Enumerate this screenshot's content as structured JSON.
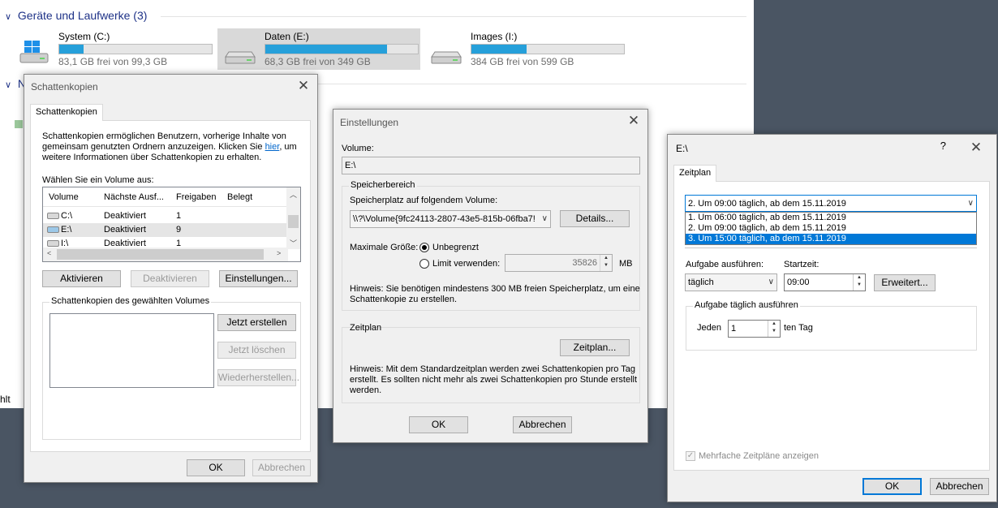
{
  "explorer": {
    "section_title": "Geräte und Laufwerke (3)",
    "section_chevron": "∨",
    "network_chevron": "∨",
    "network_letter": "N",
    "side_text": "hlt",
    "drives": [
      {
        "name": "System (C:)",
        "free": "83,1 GB frei von 99,3 GB",
        "used_fraction": 0.16,
        "icon": "windows-drive-icon"
      },
      {
        "name": "Daten (E:)",
        "free": "68,3 GB frei von 349 GB",
        "used_fraction": 0.8,
        "icon": "drive-icon"
      },
      {
        "name": "Images (I:)",
        "free": "384 GB frei von 599 GB",
        "used_fraction": 0.36,
        "icon": "drive-icon"
      }
    ]
  },
  "shadow_dialog": {
    "title": "Schattenkopien",
    "tab": "Schattenkopien",
    "intro_1": "Schattenkopien ermöglichen Benutzern, vorherige Inhalte von",
    "intro_2": "gemeinsam genutzten Ordnern anzuzeigen. Klicken Sie",
    "intro_link": "hier",
    "intro_2b": ", um",
    "intro_3": "weitere Informationen über Schattenkopien zu erhalten.",
    "volume_label": "Wählen Sie ein Volume aus:",
    "columns": [
      "Volume",
      "Nächste Ausf...",
      "Freigaben",
      "Belegt"
    ],
    "rows": [
      {
        "volume": "C:\\",
        "next": "Deaktiviert",
        "shares": "1"
      },
      {
        "volume": "E:\\",
        "next": "Deaktiviert",
        "shares": "9"
      },
      {
        "volume": "I:\\",
        "next": "Deaktiviert",
        "shares": "1"
      }
    ],
    "btn_enable": "Aktivieren",
    "btn_disable": "Deaktivieren",
    "btn_settings": "Einstellungen...",
    "copies_label": "Schattenkopien des gewählten Volumes",
    "btn_create": "Jetzt erstellen",
    "btn_delete": "Jetzt löschen",
    "btn_restore": "Wiederherstellen...",
    "btn_ok": "OK",
    "btn_cancel": "Abbrechen"
  },
  "settings_dialog": {
    "title": "Einstellungen",
    "volume_label": "Volume:",
    "volume_value": "E:\\",
    "storage_group": "Speicherbereich",
    "storage_on_label": "Speicherplatz auf folgendem Volume:",
    "storage_volume": "\\\\?\\Volume{9fc24113-2807-43e5-815b-06fba7!",
    "btn_details": "Details...",
    "max_size_label": "Maximale Größe:",
    "unlimited": "Unbegrenzt",
    "use_limit": "Limit verwenden:",
    "limit_value": "35826",
    "limit_unit": "MB",
    "hint_storage_1": "Hinweis: Sie benötigen mindestens 300 MB freien Speicherplatz, um eine",
    "hint_storage_2": "Schattenkopie zu erstellen.",
    "schedule_group": "Zeitplan",
    "btn_schedule": "Zeitplan...",
    "hint_schedule_1": "Hinweis: Mit dem Standardzeitplan werden zwei Schattenkopien pro Tag",
    "hint_schedule_2": "erstellt. Es sollten nicht mehr als zwei Schattenkopien pro Stunde erstellt",
    "hint_schedule_3": "werden.",
    "btn_ok": "OK",
    "btn_cancel": "Abbrechen"
  },
  "schedule_dialog": {
    "title": "E:\\",
    "help": "?",
    "tab": "Zeitplan",
    "selected_schedule": "2. Um 09:00 täglich, ab dem 15.11.2019",
    "options": [
      {
        "label": "1. Um 06:00 täglich, ab dem 15.11.2019",
        "selected": false
      },
      {
        "label": "2. Um 09:00 täglich, ab dem 15.11.2019",
        "selected": false
      },
      {
        "label": "3. Um 15:00 täglich, ab dem 15.11.2019",
        "selected": true
      }
    ],
    "task_label": "Aufgabe ausführen:",
    "task_value": "täglich",
    "start_label": "Startzeit:",
    "start_value": "09:00",
    "btn_advanced": "Erweitert...",
    "daily_group": "Aufgabe täglich ausführen",
    "every_label": "Jeden",
    "every_value": "1",
    "day_suffix": "ten Tag",
    "multi_label": "Mehrfache Zeitpläne anzeigen",
    "btn_ok": "OK",
    "btn_cancel": "Abbrechen"
  },
  "colors": {
    "accent": "#0078d7",
    "section_header": "#1e3287",
    "drive_bar": "#26a0da",
    "desktop": "#4a5563",
    "dialog_bg": "#f0f0f0"
  }
}
